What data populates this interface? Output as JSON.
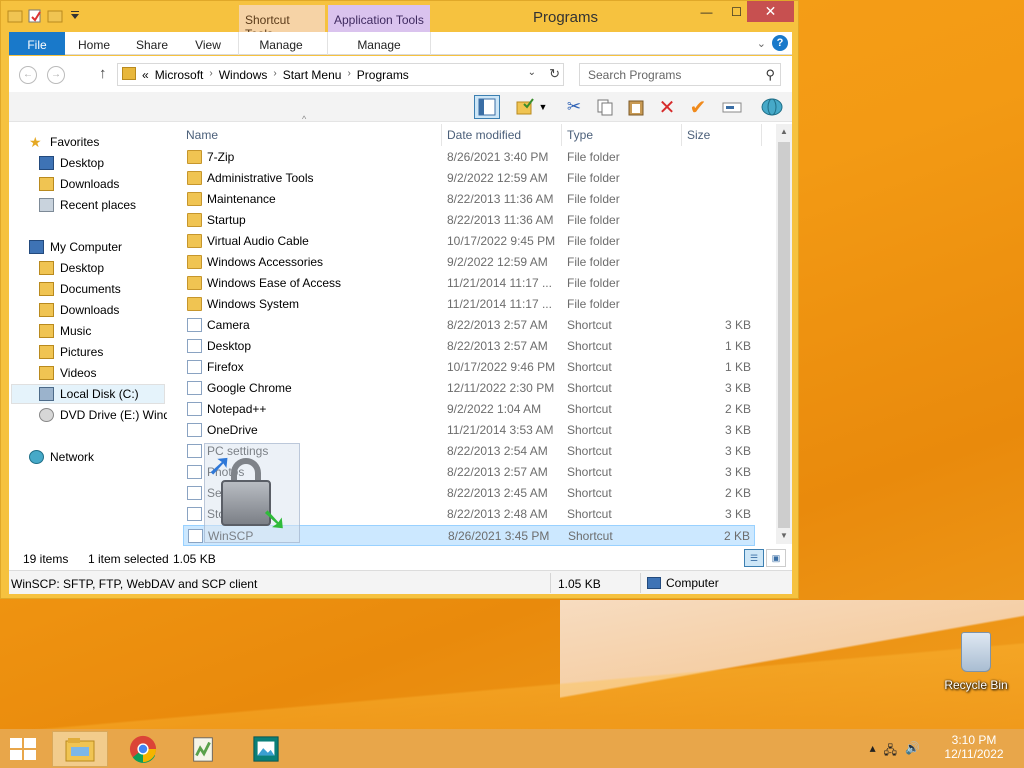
{
  "window": {
    "title": "Programs",
    "context_tabs": [
      "Shortcut Tools",
      "Application Tools"
    ],
    "controls": {
      "minimize": "—",
      "maximize": "☐",
      "close": "✕"
    }
  },
  "ribbon": {
    "tabs": [
      "File",
      "Home",
      "Share",
      "View",
      "Manage",
      "Manage"
    ],
    "expand_glyph": "⌄",
    "help_glyph": "?"
  },
  "address": {
    "back_glyph": "←",
    "forward_glyph": "→",
    "up_glyph": "↑",
    "prefix": "«",
    "crumbs": [
      "Microsoft",
      "Windows",
      "Start Menu",
      "Programs"
    ],
    "crumb_sep": "›",
    "drop_glyph": "⌄",
    "refresh_glyph": "↻",
    "search_placeholder": "Search Programs",
    "search_glyph": "⚲"
  },
  "toolbar": {
    "glyphs": {
      "cut": "✂",
      "delete": "✕",
      "check": "✔"
    }
  },
  "nav": {
    "favorites": {
      "header": "Favorites",
      "items": [
        "Desktop",
        "Downloads",
        "Recent places"
      ]
    },
    "computer": {
      "header": "My Computer",
      "items": [
        "Desktop",
        "Documents",
        "Downloads",
        "Music",
        "Pictures",
        "Videos",
        "Local Disk (C:)",
        "DVD Drive (E:) Windo"
      ]
    },
    "network": "Network"
  },
  "columns": {
    "name": "Name",
    "date": "Date modified",
    "type": "Type",
    "size": "Size",
    "sort_glyph": "^"
  },
  "files": [
    {
      "name": "7-Zip",
      "date": "8/26/2021 3:40 PM",
      "type": "File folder",
      "size": "",
      "icon": "folder-icon"
    },
    {
      "name": "Administrative Tools",
      "date": "9/2/2022 12:59 AM",
      "type": "File folder",
      "size": "",
      "icon": "folder-icon"
    },
    {
      "name": "Maintenance",
      "date": "8/22/2013 11:36 AM",
      "type": "File folder",
      "size": "",
      "icon": "folder-icon"
    },
    {
      "name": "Startup",
      "date": "8/22/2013 11:36 AM",
      "type": "File folder",
      "size": "",
      "icon": "folder-icon"
    },
    {
      "name": "Virtual Audio Cable",
      "date": "10/17/2022 9:45 PM",
      "type": "File folder",
      "size": "",
      "icon": "folder-icon"
    },
    {
      "name": "Windows Accessories",
      "date": "9/2/2022 12:59 AM",
      "type": "File folder",
      "size": "",
      "icon": "folder-icon"
    },
    {
      "name": "Windows Ease of Access",
      "date": "11/21/2014 11:17 ...",
      "type": "File folder",
      "size": "",
      "icon": "folder-icon"
    },
    {
      "name": "Windows System",
      "date": "11/21/2014 11:17 ...",
      "type": "File folder",
      "size": "",
      "icon": "folder-icon"
    },
    {
      "name": "Camera",
      "date": "8/22/2013 2:57 AM",
      "type": "Shortcut",
      "size": "3 KB",
      "icon": "camera-shortcut-icon"
    },
    {
      "name": "Desktop",
      "date": "8/22/2013 2:57 AM",
      "type": "Shortcut",
      "size": "1 KB",
      "icon": "desktop-shortcut-icon"
    },
    {
      "name": "Firefox",
      "date": "10/17/2022 9:46 PM",
      "type": "Shortcut",
      "size": "1 KB",
      "icon": "firefox-shortcut-icon"
    },
    {
      "name": "Google Chrome",
      "date": "12/11/2022 2:30 PM",
      "type": "Shortcut",
      "size": "3 KB",
      "icon": "chrome-shortcut-icon"
    },
    {
      "name": "Notepad++",
      "date": "9/2/2022 1:04 AM",
      "type": "Shortcut",
      "size": "2 KB",
      "icon": "notepadpp-shortcut-icon"
    },
    {
      "name": "OneDrive",
      "date": "11/21/2014 3:53 AM",
      "type": "Shortcut",
      "size": "3 KB",
      "icon": "onedrive-shortcut-icon"
    },
    {
      "name": "PC settings",
      "date": "8/22/2013 2:54 AM",
      "type": "Shortcut",
      "size": "3 KB",
      "icon": "pc-settings-shortcut-icon"
    },
    {
      "name": "Photos",
      "date": "8/22/2013 2:57 AM",
      "type": "Shortcut",
      "size": "3 KB",
      "icon": "photos-shortcut-icon"
    },
    {
      "name": "Search",
      "date": "8/22/2013 2:45 AM",
      "type": "Shortcut",
      "size": "2 KB",
      "icon": "search-shortcut-icon"
    },
    {
      "name": "Store",
      "date": "8/22/2013 2:48 AM",
      "type": "Shortcut",
      "size": "3 KB",
      "icon": "store-shortcut-icon"
    },
    {
      "name": "WinSCP",
      "date": "8/26/2021 3:45 PM",
      "type": "Shortcut",
      "size": "2 KB",
      "icon": "winscp-shortcut-icon",
      "selected": true
    }
  ],
  "status": {
    "count": "19 items",
    "selected": "1 item selected",
    "size": "1.05 KB"
  },
  "infobar": {
    "description": "WinSCP: SFTP, FTP, WebDAV and SCP client",
    "size": "1.05 KB",
    "location": "Computer"
  },
  "desktop": {
    "recycle_bin": "Recycle Bin"
  },
  "taskbar": {
    "apps": [
      "file-explorer",
      "google-chrome",
      "notepad-plus-plus",
      "image-viewer"
    ],
    "tray_up_glyph": "▴",
    "tray_glyphs": [
      "🖧",
      "🔊"
    ],
    "time": "3:10 PM",
    "date": "12/11/2022"
  },
  "colors": {
    "accent": "#1979ca",
    "title_bar": "#f6c23f",
    "selection": "#cce8ff",
    "desktop": "#f39a14"
  }
}
